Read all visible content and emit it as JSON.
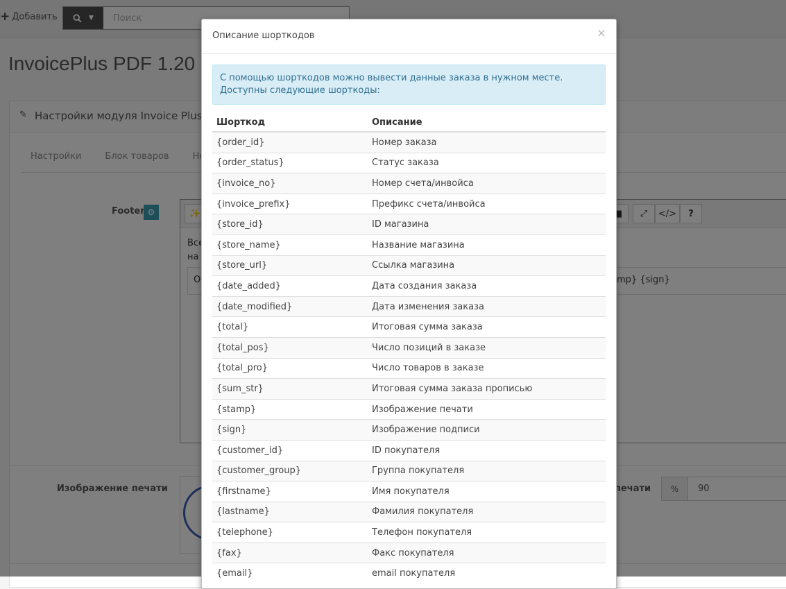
{
  "topbar": {
    "add_label": "Добавить",
    "search_placeholder": "Поиск"
  },
  "page": {
    "title": "InvoicePlus PDF 1.20",
    "panel_title": "Настройки модуля Invoice Plus",
    "tabs": [
      "Настройки",
      "Блок товаров",
      "Hea"
    ],
    "footer_label": "Footer",
    "editor_text_line1": "Все",
    "editor_text_line2": "на с",
    "editor_field_left": "O",
    "editor_field_right": "mp} {sign}",
    "stamp_label": "Изображение печати",
    "stamp_right_label": "печати",
    "percent_addon": "%",
    "percent_value": "90"
  },
  "modal": {
    "title": "Описание шорткодов",
    "close": "×",
    "alert_line1": "С помощью шорткодов можно вывести данные заказа в нужном месте.",
    "alert_line2": "Доступны следующие шорткоды:",
    "columns": [
      "Шорткод",
      "Описание"
    ],
    "rows": [
      [
        "{order_id}",
        "Номер заказа"
      ],
      [
        "{order_status}",
        "Статус заказа"
      ],
      [
        "{invoice_no}",
        "Номер счета/инвойса"
      ],
      [
        "{invoice_prefix}",
        "Префикс счета/инвойса"
      ],
      [
        "{store_id}",
        "ID магазина"
      ],
      [
        "{store_name}",
        "Название магазина"
      ],
      [
        "{store_url}",
        "Ссылка магазина"
      ],
      [
        "{date_added}",
        "Дата создания заказа"
      ],
      [
        "{date_modified}",
        "Дата изменения заказа"
      ],
      [
        "{total}",
        "Итоговая сумма заказа"
      ],
      [
        "{total_pos}",
        "Число позиций в заказе"
      ],
      [
        "{total_pro}",
        "Число товаров в заказе"
      ],
      [
        "{sum_str}",
        "Итоговая сумма заказа прописью"
      ],
      [
        "{stamp}",
        "Изображение печати"
      ],
      [
        "{sign}",
        "Изображение подписи"
      ],
      [
        "{customer_id}",
        "ID покупателя"
      ],
      [
        "{customer_group}",
        "Группа покупателя"
      ],
      [
        "{firstname}",
        "Имя покупателя"
      ],
      [
        "{lastname}",
        "Фамилия покупателя"
      ],
      [
        "{telephone}",
        "Телефон покупателя"
      ],
      [
        "{fax}",
        "Факс покупателя"
      ],
      [
        "{email}",
        "email покупателя"
      ]
    ]
  },
  "colors": {
    "alert_bg": "#d9edf7",
    "alert_text": "#31708f",
    "accent_badge": "#3a9fb3"
  }
}
